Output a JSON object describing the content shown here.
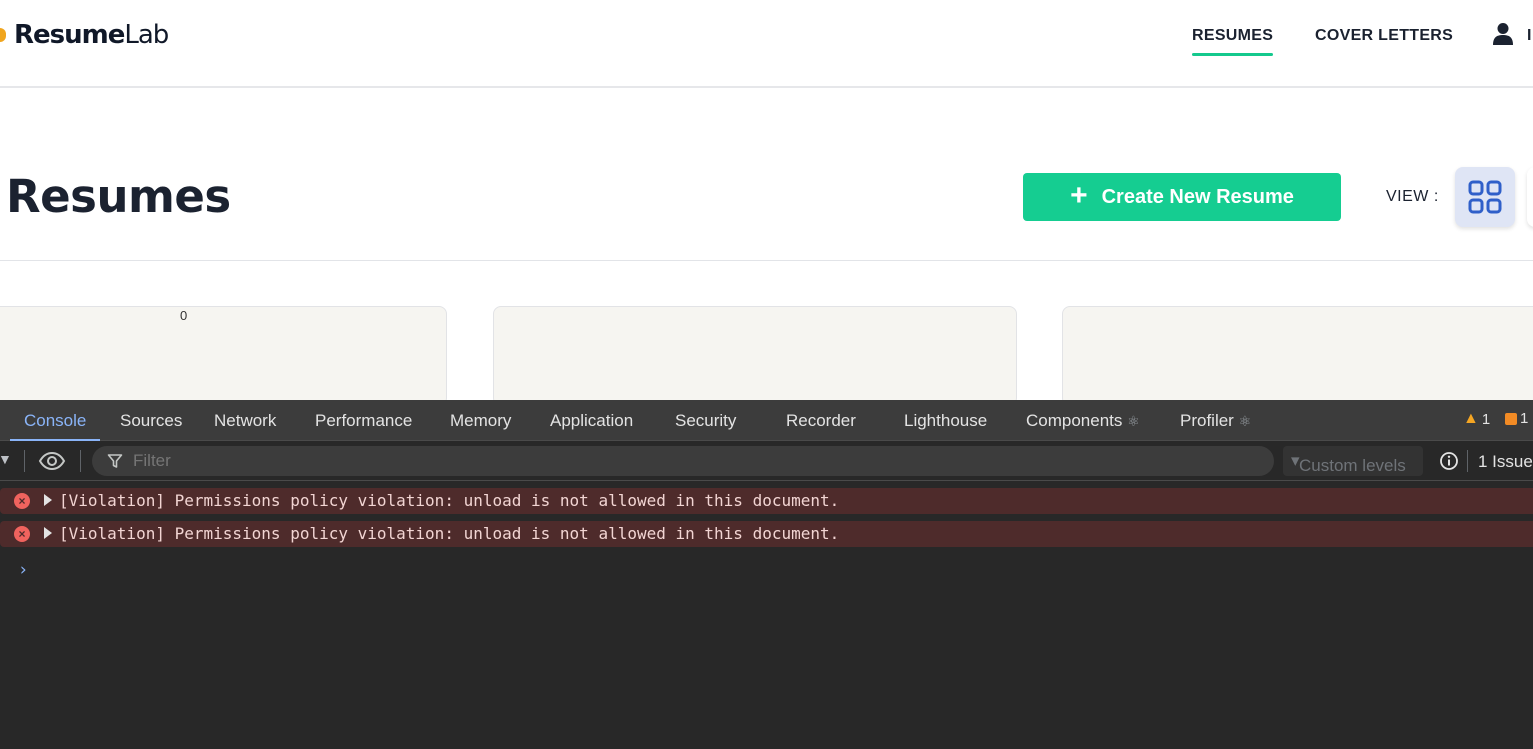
{
  "header": {
    "logo_bold": "Resume",
    "logo_light": "Lab",
    "nav": [
      {
        "label": "RESUMES",
        "active": true
      },
      {
        "label": "COVER LETTERS",
        "active": false
      }
    ],
    "user_truncated": "I",
    "accent_color": "#14c98d"
  },
  "main": {
    "title": "Resumes",
    "create_button_label": "Create New Resume",
    "create_button_color": "#15cd91",
    "view_label": "VIEW :",
    "card_count": "0"
  },
  "devtools": {
    "tabs": [
      {
        "label": "Console",
        "active": true
      },
      {
        "label": "Sources"
      },
      {
        "label": "Network"
      },
      {
        "label": "Performance"
      },
      {
        "label": "Memory"
      },
      {
        "label": "Application"
      },
      {
        "label": "Security"
      },
      {
        "label": "Recorder"
      },
      {
        "label": "Lighthouse"
      },
      {
        "label": "Components"
      },
      {
        "label": "Profiler"
      }
    ],
    "warnings_count": "1",
    "issues_count": "1",
    "filter_placeholder": "Filter",
    "levels_label": "Custom levels",
    "issues_link": "1 Issue",
    "messages": [
      {
        "level": "error",
        "text": "[Violation] Permissions policy violation: unload is not allowed in this document."
      },
      {
        "level": "error",
        "text": "[Violation] Permissions policy violation: unload is not allowed in this document."
      }
    ],
    "prompt_symbol": "›"
  }
}
